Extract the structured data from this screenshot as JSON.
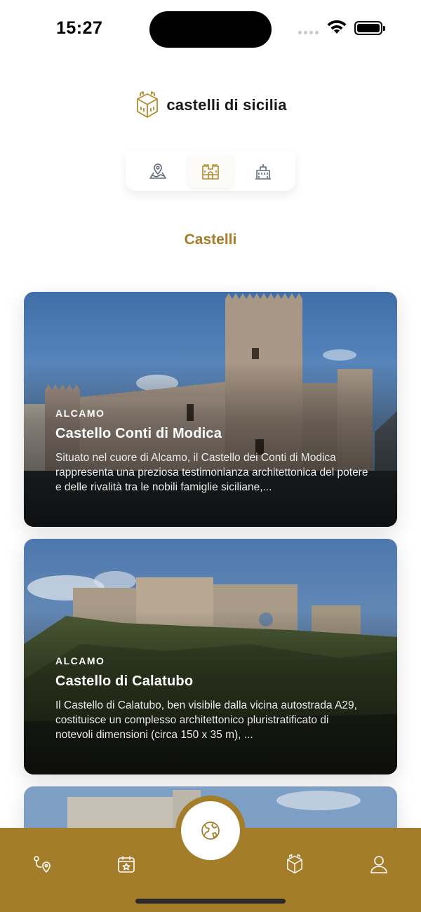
{
  "status_bar": {
    "time": "15:27"
  },
  "header": {
    "logo_text": "castelli di sicilia",
    "logo_icon": "castle-cube-icon"
  },
  "tabs": [
    {
      "icon": "map-pin-icon",
      "active": false
    },
    {
      "icon": "castle-icon",
      "active": true
    },
    {
      "icon": "building-icon",
      "active": false
    }
  ],
  "section_title": "Castelli",
  "cards": [
    {
      "location": "ALCAMO",
      "title": "Castello Conti di Modica",
      "description": "Situato nel cuore di Alcamo, il Castello dei Conti di Modica rappresenta una preziosa testimonianza architettonica del potere e delle rivalità tra le nobili famiglie siciliane,..."
    },
    {
      "location": "ALCAMO",
      "title": "Castello di Calatubo",
      "description": "Il Castello di Calatubo, ben visibile dalla vicina autostrada A29, costituisce un complesso architettonico pluristratificato di notevoli dimensioni (circa 150 x 35 m), ..."
    }
  ],
  "bottom_nav": {
    "items": [
      "route-icon",
      "calendar-star-icon",
      "globe-icon",
      "castle-cube-icon",
      "user-icon"
    ],
    "active": "globe-icon"
  },
  "colors": {
    "accent": "#a37d2a",
    "title": "#a67c2a"
  }
}
